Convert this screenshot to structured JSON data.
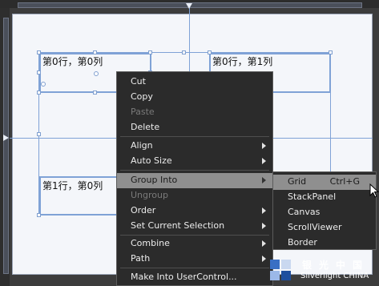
{
  "canvas": {
    "cells": [
      {
        "label": "第0行，第0列"
      },
      {
        "label": "第0行，第1列"
      },
      {
        "label": "第1行，第0列"
      }
    ]
  },
  "context_menu": {
    "items": [
      {
        "label": "Cut",
        "enabled": true
      },
      {
        "label": "Copy",
        "enabled": true
      },
      {
        "label": "Paste",
        "enabled": false
      },
      {
        "label": "Delete",
        "enabled": true
      },
      {
        "label": "Align",
        "enabled": true,
        "submenu": true
      },
      {
        "label": "Auto Size",
        "enabled": true,
        "submenu": true
      },
      {
        "label": "Group Into",
        "enabled": true,
        "submenu": true,
        "highlighted": true
      },
      {
        "label": "Ungroup",
        "enabled": false
      },
      {
        "label": "Order",
        "enabled": true,
        "submenu": true
      },
      {
        "label": "Set Current Selection",
        "enabled": true,
        "submenu": true
      },
      {
        "label": "Combine",
        "enabled": true,
        "submenu": true
      },
      {
        "label": "Path",
        "enabled": true,
        "submenu": true
      },
      {
        "label": "Make Into UserControl...",
        "enabled": true
      }
    ]
  },
  "group_into_submenu": {
    "items": [
      {
        "label": "Grid",
        "shortcut": "Ctrl+G",
        "highlighted": true
      },
      {
        "label": "StackPanel"
      },
      {
        "label": "Canvas"
      },
      {
        "label": "ScrollViewer"
      },
      {
        "label": "Border"
      }
    ]
  },
  "watermark": {
    "line1": "银光中国",
    "line2": "Silverlight CHINA"
  },
  "colors": {
    "menu_bg": "#2b2b2b",
    "menu_highlight": "#8f8f8f",
    "guide_blue": "#7fa2d6",
    "canvas_bg": "#f4f6fa"
  }
}
